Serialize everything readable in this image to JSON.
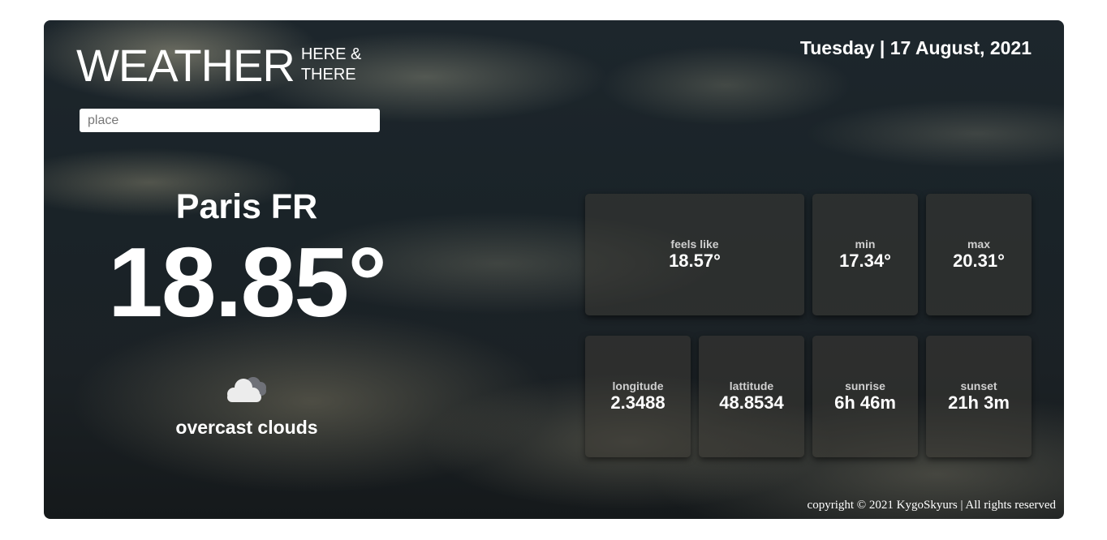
{
  "header": {
    "brand_main": "WEATHER",
    "brand_sub_line1": "HERE &",
    "brand_sub_line2": "THERE",
    "date": "Tuesday | 17 August, 2021"
  },
  "search": {
    "placeholder": "place",
    "value": ""
  },
  "current": {
    "city": "Paris FR",
    "temperature": "18.85°",
    "icon": "cloud-icon",
    "description": "overcast clouds"
  },
  "stats": {
    "feels_like": {
      "label": "feels like",
      "value": "18.57°"
    },
    "min": {
      "label": "min",
      "value": "17.34°"
    },
    "max": {
      "label": "max",
      "value": "20.31°"
    },
    "longitude": {
      "label": "longitude",
      "value": "2.3488"
    },
    "latitude": {
      "label": "lattitude",
      "value": "48.8534"
    },
    "sunrise": {
      "label": "sunrise",
      "value": "6h 46m"
    },
    "sunset": {
      "label": "sunset",
      "value": "21h 3m"
    }
  },
  "footer": {
    "copyright": "copyright © 2021 KygoSkyurs | All rights reserved"
  },
  "colors": {
    "text": "#ffffff",
    "card_label": "#cfcfcf",
    "card_background": "#3c3a34"
  }
}
